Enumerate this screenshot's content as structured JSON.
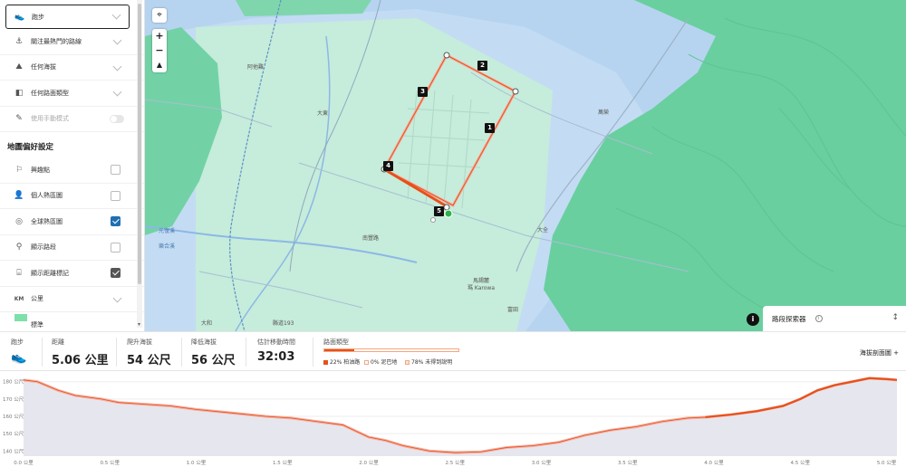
{
  "sidebar": {
    "items": [
      {
        "label": "跑步",
        "icon": "shoe-icon",
        "type": "dropdown"
      },
      {
        "label": "關注最熱門的路線",
        "icon": "popularity-icon",
        "type": "dropdown"
      },
      {
        "label": "任何海拔",
        "icon": "mountain-icon",
        "type": "dropdown"
      },
      {
        "label": "任何路面類型",
        "icon": "surface-icon",
        "type": "dropdown"
      },
      {
        "label": "使用手動模式",
        "icon": "pencil-icon",
        "type": "toggle",
        "value": false
      }
    ],
    "prefs_heading": "地圖偏好設定",
    "prefs": [
      {
        "label": "興趣點",
        "icon": "flag-icon",
        "checked": false
      },
      {
        "label": "個人熱區圖",
        "icon": "person-icon",
        "checked": false
      },
      {
        "label": "全球熱區圖",
        "icon": "globe-icon",
        "checked": true
      },
      {
        "label": "顯示路段",
        "icon": "segment-icon",
        "checked": false
      },
      {
        "label": "顯示距離標記",
        "icon": "distance-marker-icon",
        "checked": true
      }
    ],
    "units_label": "公里",
    "units_icon": "KM",
    "legend_label": "標準",
    "legend_color": "#7ee0a9"
  },
  "map": {
    "labels": [
      "阿他難",
      "大東",
      "大和",
      "南豐路",
      "樂合溪",
      "萬榮",
      "光復溪",
      "馬錫麓",
      "大全",
      "富田",
      "瑪 Karowa",
      "縣道193",
      "大豐",
      "台九線",
      "東富路",
      "大和",
      "豐田",
      "台11丙"
    ],
    "markers": [
      "1",
      "2",
      "3",
      "4",
      "5"
    ],
    "segment_explorer": "路段探索器",
    "colors": {
      "water": "#b9d6f2",
      "land": "#a9cde6",
      "heat": "#c9efe0",
      "mountain": "#6fd3a6",
      "route": "#e8501a"
    }
  },
  "stats": {
    "sport_label": "跑步",
    "items": [
      {
        "label": "距離",
        "value": "5.06 公里"
      },
      {
        "label": "爬升海拔",
        "value": "54 公尺"
      },
      {
        "label": "降低海拔",
        "value": "56 公尺"
      },
      {
        "label": "估計移動時間",
        "value": "32:03"
      }
    ],
    "surface_label": "路面類型",
    "surface_legend": [
      "22% 柏油路",
      "0% 泥巴地",
      "78% 未得到說明"
    ],
    "surface_paved_pct": 22,
    "elev_toggle": "海拔剖面圖 +"
  },
  "chart_data": {
    "type": "area",
    "ylabel": "",
    "xlabel": "",
    "y_ticks": [
      "180 公尺",
      "170 公尺",
      "160 公尺",
      "150 公尺",
      "140 公尺"
    ],
    "x_ticks": [
      "0.0 公里",
      "0.5 公里",
      "1.0 公里",
      "1.5 公里",
      "2.0 公里",
      "2.5 公里",
      "3.0 公里",
      "3.5 公里",
      "4.0 公里",
      "4.5 公里",
      "5.0 公里"
    ],
    "ylim": [
      137,
      183
    ],
    "xlim": [
      0,
      5.06
    ],
    "series": [
      {
        "x": [
          0.0,
          0.08,
          0.2,
          0.3,
          0.45,
          0.55,
          0.7,
          0.85,
          1.0,
          1.2,
          1.4,
          1.55,
          1.7,
          1.85,
          2.0,
          2.1,
          2.2,
          2.35,
          2.5,
          2.65,
          2.8,
          2.95,
          3.1,
          3.25,
          3.4,
          3.55,
          3.7,
          3.85,
          3.95,
          4.1,
          4.25,
          4.4,
          4.5,
          4.6,
          4.7,
          4.8,
          4.9,
          5.0,
          5.06
        ],
        "y": [
          181,
          180,
          175,
          172,
          170,
          168,
          167,
          166,
          164,
          162,
          160,
          159,
          157,
          155,
          148,
          146,
          143,
          140,
          139,
          139.5,
          142,
          143,
          145,
          149,
          152,
          154,
          157,
          159,
          159.5,
          161,
          163,
          166,
          170,
          175,
          178,
          180,
          182,
          181.5,
          181
        ]
      }
    ],
    "highlight_from_km": 3.95
  }
}
